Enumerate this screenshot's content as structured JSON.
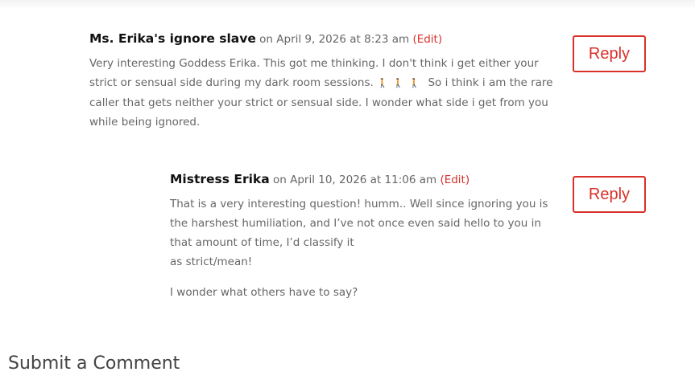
{
  "comments": [
    {
      "author": "Ms. Erika's ignore slave",
      "date": "on April 9, 2026 at 8:23 am",
      "edit": "(Edit)",
      "text_before": "Very interesting Goddess Erika. This got me thinking. I don't think i get either your strict or sensual side during my dark room sessions.",
      "emoji": "🚶🚶🚶",
      "text_after": "So i think i am the rare caller that gets neither your strict or sensual side. I wonder what side i get from you while being ignored.",
      "reply": "Reply"
    },
    {
      "author": "Mistress Erika",
      "date": "on April 10, 2026 at 11:06 am",
      "edit": "(Edit)",
      "paragraph1_line1": "That is a very interesting question! humm.. Well since ignoring you is the harshest humiliation, and I’ve not once even said hello to you in that amount of time, I’d classify it",
      "paragraph1_line2": "as strict/mean!",
      "paragraph2": "I wonder what others have to say?",
      "reply": "Reply"
    }
  ],
  "submit_title": "Submit a Comment",
  "colors": {
    "accent": "#d9302a",
    "text": "#666666",
    "author": "#111111"
  }
}
